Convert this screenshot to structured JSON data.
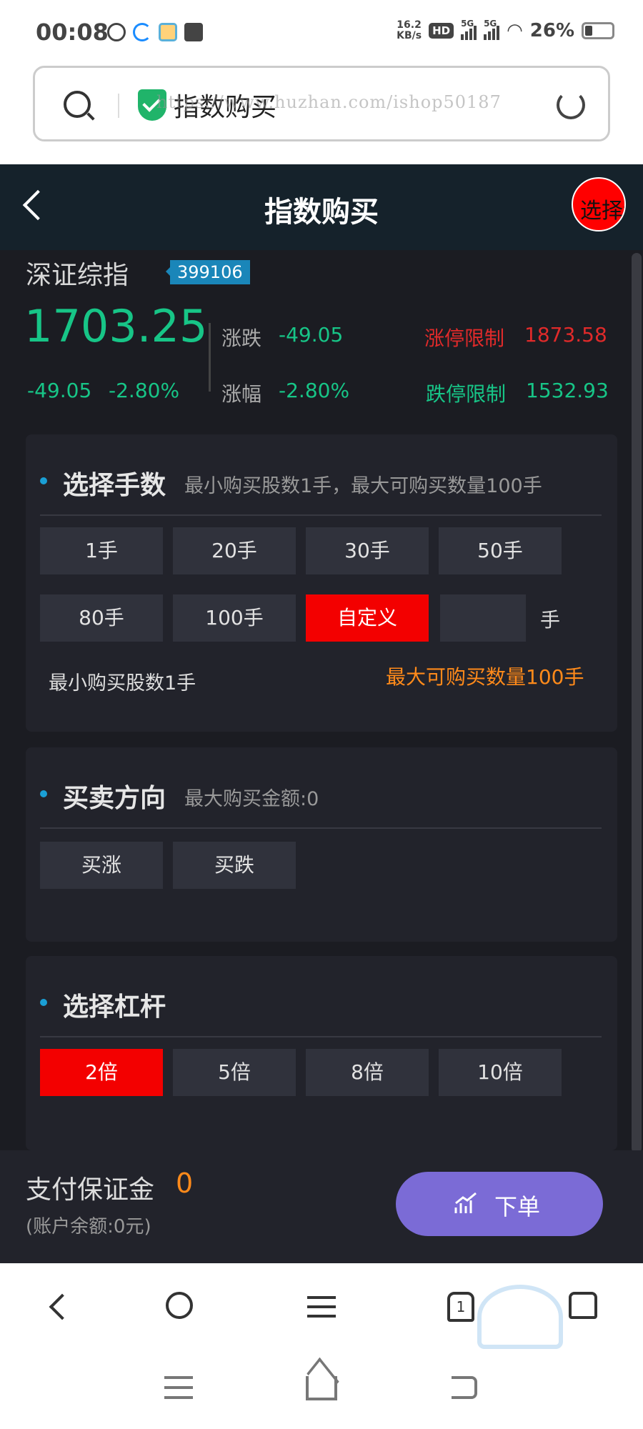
{
  "status_bar": {
    "time": "00:08",
    "net_speed_value": "16.2",
    "net_speed_unit": "KB/s",
    "hd_label": "HD",
    "sig1": "5G",
    "sig2": "5G",
    "battery": "26%"
  },
  "browser": {
    "address_title": "指数购买",
    "watermark": "https://www.huzhan.com/ishop50187"
  },
  "header": {
    "title": "指数购买",
    "lang_button": "选择语言"
  },
  "stock": {
    "name": "深证综指",
    "code": "399106",
    "price": "1703.25",
    "change": "-49.05",
    "change_pct": "-2.80%",
    "label_change": "涨跌",
    "value_change": "-49.05",
    "label_pct": "涨幅",
    "value_pct": "-2.80%",
    "limit_up_label": "涨停限制",
    "limit_up_value": "1873.58",
    "limit_down_label": "跌停限制",
    "limit_down_value": "1532.93"
  },
  "lots": {
    "title": "选择手数",
    "subtitle": "最小购买股数1手，最大可购买数量100手",
    "options": [
      "1手",
      "20手",
      "30手",
      "50手",
      "80手",
      "100手",
      "自定义"
    ],
    "unit": "手",
    "min_note": "最小购买股数1手",
    "max_note": "最大可购买数量100手"
  },
  "direction": {
    "title": "买卖方向",
    "subtitle": "最大购买金额:0",
    "options": [
      "买涨",
      "买跌"
    ]
  },
  "leverage": {
    "title": "选择杠杆",
    "options": [
      "2倍",
      "5倍",
      "8倍",
      "10倍"
    ]
  },
  "footer": {
    "pay_label": "支付保证金",
    "pay_amount": "0",
    "balance": "(账户余额:0元)",
    "order_button": "下单"
  },
  "browser_nav": {
    "tab_count": "1"
  },
  "colors": {
    "green": "#17c587",
    "red": "#e02a2a",
    "active": "#f30000",
    "orange": "#ff8a1a",
    "purple": "#7b6bd6"
  }
}
